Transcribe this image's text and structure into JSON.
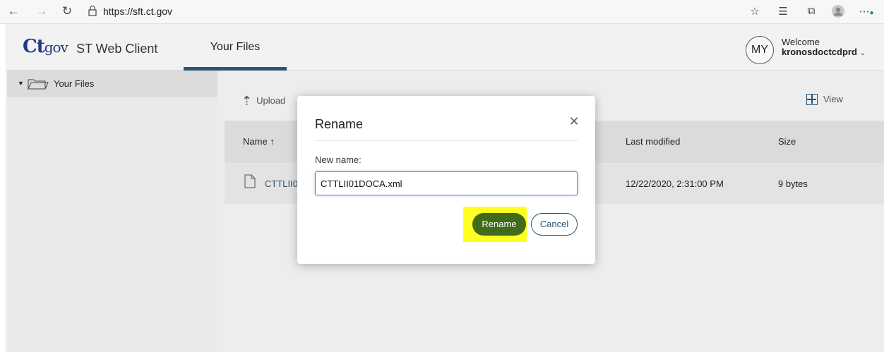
{
  "browser": {
    "url": "https://sft.ct.gov",
    "icons": [
      "back-icon",
      "forward-icon",
      "refresh-icon",
      "lock-icon",
      "favorite-star-icon",
      "favorites-list-icon",
      "collections-icon",
      "profile-icon",
      "more-icon"
    ]
  },
  "header": {
    "logo_main": "Ct",
    "logo_suffix": "gov",
    "app_title": "ST Web Client",
    "tab_files": "Your Files",
    "avatar_initials": "MY",
    "welcome_label": "Welcome",
    "username": "kronosdoctcdprd"
  },
  "sidebar": {
    "items": [
      {
        "label": "Your Files"
      }
    ]
  },
  "toolbar": {
    "upload_label": "Upload",
    "view_label": "View"
  },
  "table": {
    "columns": [
      "Name",
      "Last modified",
      "Size"
    ],
    "rows": [
      {
        "name": "CTTLII0",
        "modified": "12/22/2020, 2:31:00 PM",
        "size": "9 bytes"
      }
    ]
  },
  "dialog": {
    "title": "Rename",
    "field_label": "New name:",
    "field_value": "CTTLII01DOCA.xml",
    "rename_button": "Rename",
    "cancel_button": "Cancel"
  },
  "colors": {
    "accent": "#2b5672",
    "rename_button": "#3f6b1a",
    "highlight": "#ffff00"
  }
}
